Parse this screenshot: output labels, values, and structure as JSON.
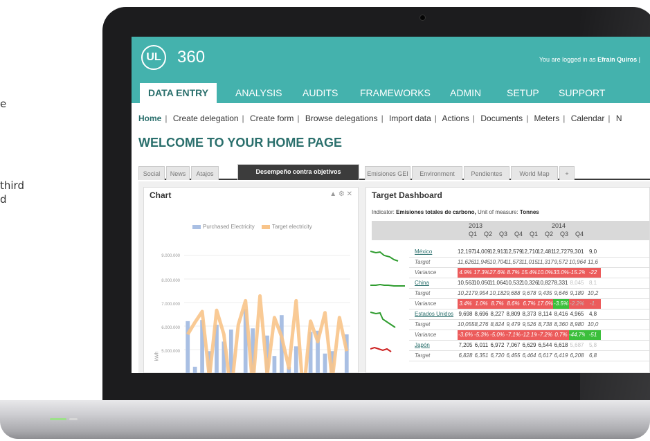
{
  "page_fragments": {
    "line1": "e",
    "line2": "third",
    "line3": "d"
  },
  "brand": {
    "logo": "UL",
    "number": "360"
  },
  "login": {
    "prefix": "You are logged in as",
    "user": "Efrain Quiros",
    "suffix": "|"
  },
  "nav": {
    "tabs": [
      "DATA ENTRY",
      "ANALYSIS",
      "AUDITS",
      "FRAMEWORKS",
      "ADMIN",
      "SETUP",
      "SUPPORT"
    ],
    "active": "DATA ENTRY"
  },
  "subnav": [
    "Home",
    "Create delegation",
    "Create form",
    "Browse delegations",
    "Import data",
    "Actions",
    "Documents",
    "Meters",
    "Calendar",
    "N"
  ],
  "page_title": "WELCOME TO YOUR HOME PAGE",
  "widget_tabs": [
    "Social",
    "News",
    "Atajos",
    "Desempeño contra objetivos",
    "Emisiones GEI",
    "Environment",
    "Pendientes",
    "World Map",
    "+"
  ],
  "active_widget_tab": "Desempeño contra objetivos",
  "chart_panel": {
    "title": "Chart",
    "tools": "▲ ⚙ ✕",
    "legend": [
      "Purchased Electricity",
      "Target electricity"
    ],
    "ylabel": "kWh",
    "colors": {
      "bars": "#a9bfe3",
      "line": "#f8c48a"
    }
  },
  "chart_data": {
    "type": "bar",
    "series": [
      {
        "name": "Purchased Electricity",
        "values": [
          6650000,
          4750000,
          6700000,
          5400000,
          6500000,
          5800000,
          6300000,
          3900000,
          7150000,
          6350000,
          4450000,
          6050000,
          5200000,
          6900000,
          4750000,
          5600000,
          3200000,
          6200000,
          6250000,
          5300000,
          5400000,
          4300000,
          6100000
        ]
      },
      {
        "name": "Target electricity",
        "values": [
          6100000,
          6600000,
          7050000,
          4300000,
          7100000,
          6100000,
          3650000,
          6500000,
          7500000,
          3900000,
          7700000,
          4400000,
          6800000,
          6000000,
          4700000,
          7500000,
          3550000,
          6650000,
          5800000,
          7000000,
          4200000,
          6800000,
          5400000
        ]
      }
    ],
    "ytick_labels": [
      "9.000.000",
      "8.000.000",
      "7.000.000",
      "6.000.000",
      "5.000.000"
    ],
    "ylabel": "kWh",
    "ylim": [
      4600000,
      9500000
    ]
  },
  "dashboard": {
    "title": "Target Dashboard",
    "indicator_prefix": "Indicator:",
    "indicator_name": "Emisiones totales de carbono,",
    "unit_prefix": "Unit of measure:",
    "unit_name": "Tonnes",
    "years": [
      "2013",
      "2014",
      "2"
    ],
    "quarters": [
      "Q1",
      "Q2",
      "Q3",
      "Q4",
      "Q1",
      "Q2",
      "Q3",
      "Q4"
    ],
    "rows": [
      {
        "label": "México",
        "kind": "country",
        "cells": [
          "12,197",
          "14,009",
          "12,913",
          "12,579",
          "12,710",
          "12,481",
          "12,727",
          "9,301",
          "9,0"
        ]
      },
      {
        "label": "Target",
        "kind": "target",
        "cells": [
          "11,626",
          "11,945",
          "10,704",
          "11,573",
          "11,015",
          "11,317",
          "9,572",
          "10,964",
          "11,6"
        ]
      },
      {
        "label": "Variance",
        "kind": "variance",
        "cells": [
          "4.9%",
          "17.3%",
          "27.6%",
          "8.7%",
          "15.4%",
          "10.0%",
          "33.0%",
          "-15.2%",
          "-22"
        ]
      },
      {
        "label": "China",
        "kind": "country",
        "cells": [
          "10,563",
          "10,050",
          "11,064",
          "10,532",
          "10,326",
          "10,827",
          "8,331",
          "8,045",
          "8,1"
        ]
      },
      {
        "label": "Target",
        "kind": "target",
        "cells": [
          "10,217",
          "9,954",
          "10,182",
          "9,688",
          "9,678",
          "9,435",
          "9,646",
          "9,189",
          "10,2"
        ]
      },
      {
        "label": "Variance",
        "kind": "variance",
        "cells": [
          "3.4%",
          "1.0%",
          "8.7%",
          "8.6%",
          "6.7%",
          "17.6%",
          "-3.5%",
          "-2.2%",
          "-1."
        ]
      },
      {
        "label": "Estados Unidos",
        "kind": "country",
        "cells": [
          "9,698",
          "8,696",
          "8,227",
          "8,809",
          "8,373",
          "8,114",
          "8,416",
          "4,965",
          "4,8"
        ]
      },
      {
        "label": "Target",
        "kind": "target",
        "cells": [
          "10,055",
          "8,276",
          "8,824",
          "9,479",
          "9,526",
          "8,738",
          "8,360",
          "8,980",
          "10,0"
        ]
      },
      {
        "label": "Variance",
        "kind": "variance",
        "cells": [
          "-3.6%",
          "-5.3%",
          "-5.0%",
          "-7.1%",
          "-12.1%",
          "-7.2%",
          "0.7%",
          "-44.7%",
          "-51"
        ]
      },
      {
        "label": "Japón",
        "kind": "country",
        "cells": [
          "7,205",
          "6,011",
          "6,972",
          "7,067",
          "6,629",
          "6,544",
          "6,618",
          "5,687",
          "5,8"
        ]
      },
      {
        "label": "Target",
        "kind": "target",
        "cells": [
          "6,828",
          "6,351",
          "6,720",
          "6,455",
          "6,464",
          "6,617",
          "6,419",
          "6,208",
          "6,8"
        ]
      }
    ],
    "colors": {
      "red": "#ec5b5b",
      "green": "#3bbf3b",
      "sparkline_good": "#2e9c2e",
      "sparkline_bad": "#cc1f1f"
    }
  }
}
